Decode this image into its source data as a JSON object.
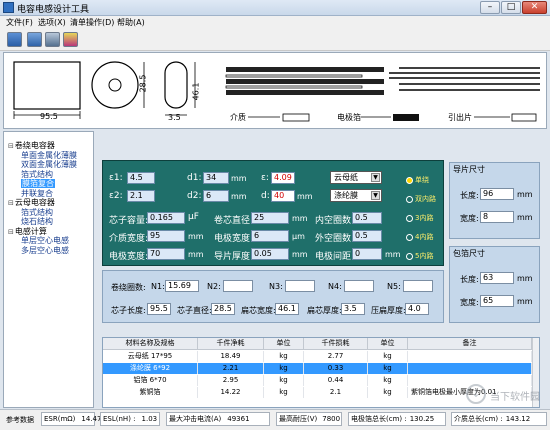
{
  "window": {
    "title": "电容电感设计工具"
  },
  "menu": [
    "文件(F)",
    "选项(X)",
    "清单操作(D)",
    "帮助(A)"
  ],
  "drawing": {
    "dim_width": "95.5",
    "dim_diameter": "28.5",
    "dim_height": "46.1",
    "dim_thickness": "3.5",
    "legend_dielectric": "介质",
    "legend_electrode": "电极箔",
    "legend_lead": "引出片"
  },
  "tree": [
    {
      "label": "卷绕电容器",
      "level": 0,
      "selected": false
    },
    {
      "label": "单面金属化薄膜",
      "level": 1,
      "selected": false
    },
    {
      "label": "双面金属化薄膜",
      "level": 1,
      "selected": false
    },
    {
      "label": "箔式结构",
      "level": 1,
      "selected": false
    },
    {
      "label": "膜箔复合",
      "level": 1,
      "selected": true
    },
    {
      "label": "并联复合",
      "level": 1,
      "selected": false
    },
    {
      "label": "云母电容器",
      "level": 0,
      "selected": false
    },
    {
      "label": "箔式结构",
      "level": 1,
      "selected": false
    },
    {
      "label": "烧石结构",
      "level": 1,
      "selected": false
    },
    {
      "label": "电感计算",
      "level": 0,
      "selected": false
    },
    {
      "label": "单层空心电感",
      "level": 1,
      "selected": false
    },
    {
      "label": "多层空心电感",
      "level": 1,
      "selected": false
    }
  ],
  "params": {
    "eps1_label": "ε1:",
    "eps1": "4.5",
    "eps2_label": "ε2:",
    "eps2": "2.1",
    "d1_label": "d1:",
    "d1": "34",
    "d1_unit": "mm",
    "d2_label": "d2:",
    "d2": "6",
    "d2_unit": "mm",
    "e_label": "ε:",
    "e_val": "4.09",
    "d_label": "d:",
    "d_val": "40",
    "d_unit": "mm",
    "mat1": "云母纸",
    "mat2": "涤纶膜",
    "cap_label": "芯子容量:",
    "cap": "0.165",
    "cap_unit": "μF",
    "wind_d_label": "卷芯直径:",
    "wind_d": "25",
    "wind_d_unit": "mm",
    "inner_gap_label": "内空圈数:",
    "inner_gap": "0.5",
    "medium_w_label": "介质宽度:",
    "medium_w": "95",
    "medium_w_unit": "mm",
    "elec_w_label": "电极宽度:",
    "elec_w": "6",
    "elec_w_unit": "μm",
    "outer_gap_label": "外空圈数:",
    "outer_gap": "0.5",
    "elec_t_label": "电极宽度:",
    "elec_t": "70",
    "elec_t_unit": "mm",
    "lead_t_label": "导片厚度:",
    "lead_t": "0.05",
    "lead_t_unit": "mm",
    "elec_dist_label": "电极间距:",
    "elec_dist": "0",
    "elec_dist_unit": "mm",
    "radios": [
      {
        "label": "单绕",
        "on": true
      },
      {
        "label": "双内路",
        "on": false
      },
      {
        "label": "3内路",
        "on": false
      },
      {
        "label": "4内路",
        "on": false
      },
      {
        "label": "5内路",
        "on": false
      }
    ]
  },
  "layers": {
    "turns_label": "卷绕圈数:",
    "n1_label": "N1:",
    "n1": "15.69",
    "n2_label": "N2:",
    "n2": "",
    "n3_label": "N3:",
    "n3": "",
    "n4_label": "N4:",
    "n4": "",
    "n5_label": "N5:",
    "n5": "",
    "core_len_label": "芯子长度:",
    "core_len": "95.5",
    "core_dia_label": "芯子直径:",
    "core_dia": "28.5",
    "flat_w_label": "扁芯宽度:",
    "flat_w": "46.1",
    "flat_t_label": "扁芯厚度:",
    "flat_t": "3.5",
    "press_t_label": "压扁厚度:",
    "press_t": "4.0"
  },
  "piece_size": {
    "title": "导片尺寸",
    "len_label": "长度:",
    "len": "96",
    "len_unit": "mm",
    "wid_label": "宽度:",
    "wid": "8",
    "wid_unit": "mm"
  },
  "pack_size": {
    "title": "包箔尺寸",
    "len_label": "长度:",
    "len": "63",
    "len_unit": "mm",
    "wid_label": "宽度:",
    "wid": "65",
    "wid_unit": "mm"
  },
  "table": {
    "headers": [
      "材料名称及规格",
      "千件净耗",
      "单位",
      "千件损耗",
      "单位",
      "备注"
    ],
    "rows": [
      {
        "name": "云母纸 17*95",
        "net": "18.49",
        "unit1": "kg",
        "loss": "2.77",
        "unit2": "kg",
        "note": "",
        "sel": false
      },
      {
        "name": "涤纶膜 6*92",
        "net": "2.21",
        "unit1": "kg",
        "loss": "0.33",
        "unit2": "kg",
        "note": "",
        "sel": true
      },
      {
        "name": "铝箔 6*70",
        "net": "2.95",
        "unit1": "kg",
        "loss": "0.44",
        "unit2": "kg",
        "note": "",
        "sel": false
      },
      {
        "name": "紫铜箔",
        "net": "14.22",
        "unit1": "kg",
        "loss": "2.1",
        "unit2": "kg",
        "note": "紫铜箔电极最小厚度为0.01",
        "sel": false
      }
    ]
  },
  "status": {
    "label": "参考数据",
    "esr_label": "ESR(mΩ)",
    "esr": "14.47",
    "esl_label": "ESL(nH) :",
    "esl": "1.03",
    "imax_label": "最大冲击电流(A)",
    "imax": "49361",
    "vmax_label": "最高耐压(V)",
    "vmax": "7800",
    "foil_len_label": "电极箔总长(cm) :",
    "foil_len": "130.25",
    "med_len_label": "介质总长(cm) :",
    "med_len": "143.12"
  },
  "watermark": "当下软件园"
}
